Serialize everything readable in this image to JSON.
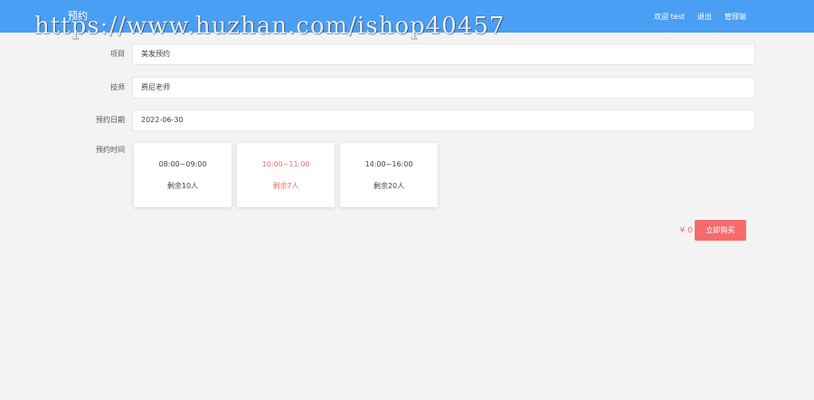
{
  "header": {
    "brand": "预约",
    "nav": [
      "欢迎 test",
      "退出",
      "管理端"
    ]
  },
  "watermark": "https://www.huzhan.com/ishop40457",
  "form": {
    "project": {
      "label": "项目",
      "value": "美发预约"
    },
    "technician": {
      "label": "技师",
      "value": "费尼老师"
    },
    "date": {
      "label": "预约日期",
      "value": "2022-06-30"
    },
    "time": {
      "label": "预约时间"
    }
  },
  "slots": [
    {
      "time": "08:00~09:00",
      "remain": "剩余10人",
      "selected": false
    },
    {
      "time": "10:00~11:00",
      "remain": "剩余7人",
      "selected": true
    },
    {
      "time": "14:00~16:00",
      "remain": "剩余20人",
      "selected": false
    }
  ],
  "purchase": {
    "price": "¥ 0",
    "button_label": "立即购买"
  },
  "colors": {
    "header": "#4a9ff5",
    "accent": "#f56c6c",
    "background": "#f3f3f3"
  }
}
